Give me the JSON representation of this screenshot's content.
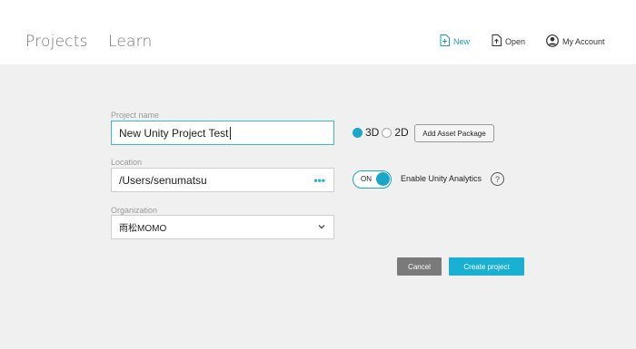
{
  "header": {
    "tabs": [
      {
        "label": "Projects"
      },
      {
        "label": "Learn"
      }
    ],
    "actions": {
      "new_label": "New",
      "open_label": "Open",
      "account_label": "My Account"
    }
  },
  "form": {
    "project_name": {
      "label": "Project name",
      "value": "New Unity Project Test"
    },
    "location": {
      "label": "Location",
      "value": "/Users/senumatsu",
      "browse_glyph": "•••"
    },
    "organization": {
      "label": "Organization",
      "value": "雨松MOMO"
    },
    "dimension": {
      "option_3d": "3D",
      "option_2d": "2D",
      "selected": "3D"
    },
    "asset_package_label": "Add Asset Package",
    "analytics": {
      "toggle_label": "ON",
      "label": "Enable Unity Analytics",
      "enabled": true,
      "help_glyph": "?"
    },
    "cancel_label": "Cancel",
    "create_label": "Create project"
  },
  "colors": {
    "accent": "#1aa6c8",
    "cancel": "#7a7a7a",
    "background": "#f0f0f0",
    "header": "#ffffff"
  }
}
